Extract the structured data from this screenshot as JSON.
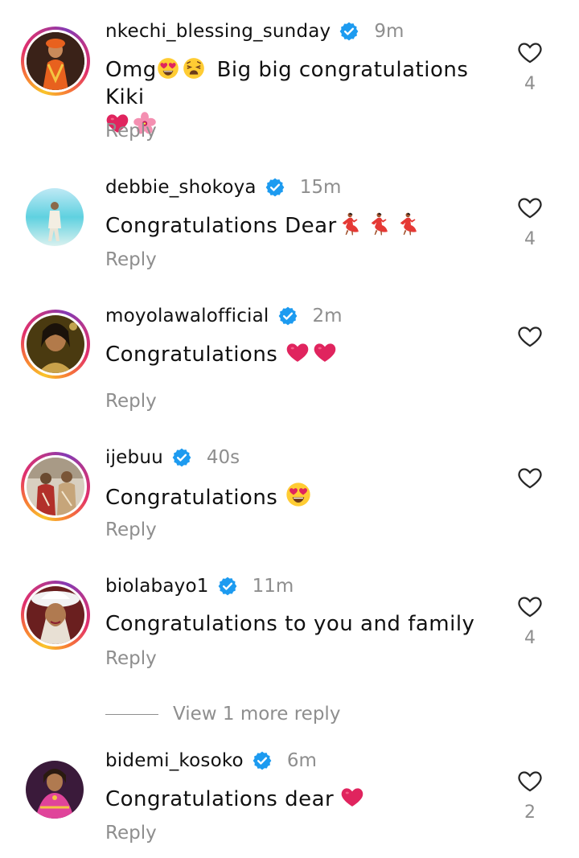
{
  "comments": [
    {
      "username": "nkechi_blessing_sunday",
      "time": "9m",
      "text": "Omg",
      "text2": "Big big congratulations Kiki",
      "reply": "Reply",
      "likes": "4"
    },
    {
      "username": "debbie_shokoya",
      "time": "15m",
      "text": "Congratulations Dear",
      "reply": "Reply",
      "likes": "4"
    },
    {
      "username": "moyolawalofficial",
      "time": "2m",
      "text": "Congratulations",
      "reply": "Reply",
      "likes": ""
    },
    {
      "username": "ijebuu",
      "time": "40s",
      "text": "Congratulations",
      "reply": "Reply",
      "likes": ""
    },
    {
      "username": "biolabayo1",
      "time": "11m",
      "text": "Congratulations to you and family",
      "reply": "Reply",
      "likes": "4"
    },
    {
      "username": "bidemi_kosoko",
      "time": "6m",
      "text": "Congratulations dear",
      "reply": "Reply",
      "likes": "2"
    }
  ],
  "view_more": "View 1 more reply",
  "colors": {
    "verified": "#1d9bf0",
    "secondary_text": "#8e8e8e",
    "heart_red": "#e0245e"
  },
  "icons": {
    "like": "heart-outline-icon",
    "verified": "verified-badge-icon"
  }
}
